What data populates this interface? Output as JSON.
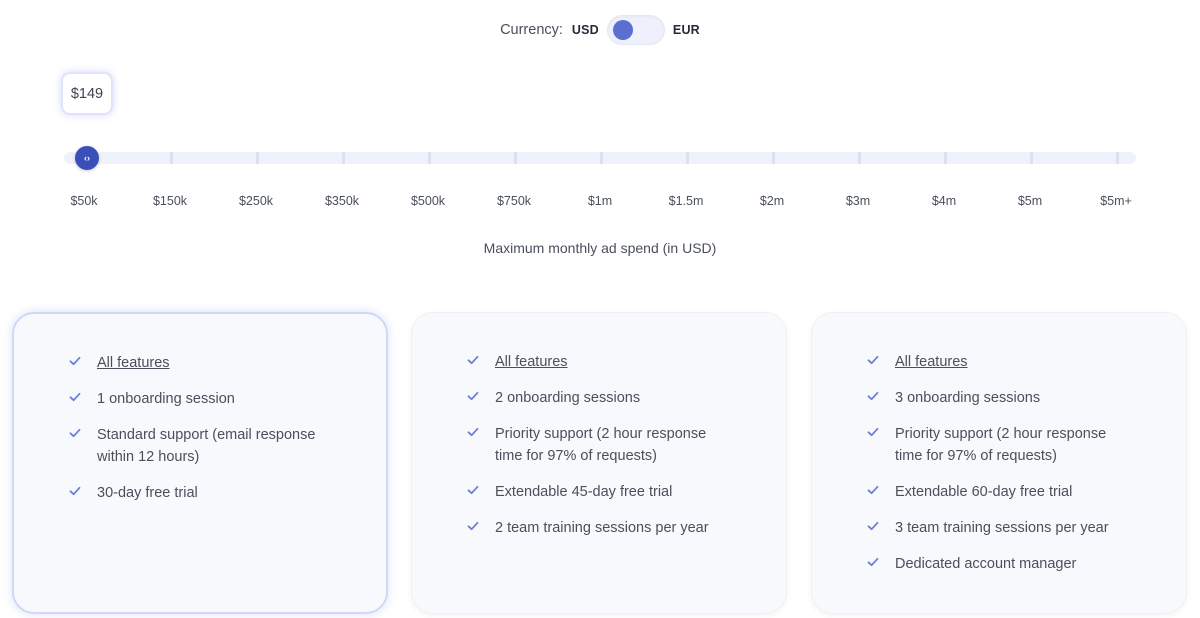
{
  "currency": {
    "label": "Currency:",
    "options": [
      "USD",
      "EUR"
    ],
    "selected": "USD"
  },
  "price": "$149",
  "slider": {
    "ticks": [
      "$50k",
      "$150k",
      "$250k",
      "$350k",
      "$500k",
      "$750k",
      "$1m",
      "$1.5m",
      "$2m",
      "$3m",
      "$4m",
      "$5m",
      "$5m+"
    ],
    "selected_index": 0,
    "thumb_icon": "‹›",
    "caption": "Maximum monthly ad spend (in USD)"
  },
  "plans": [
    {
      "selected": true,
      "features": [
        {
          "text": "All features",
          "link": true
        },
        {
          "text": "1 onboarding session"
        },
        {
          "text": "Standard support (email response",
          "text2": "within 12 hours)"
        },
        {
          "text": "30-day free trial"
        }
      ]
    },
    {
      "selected": false,
      "features": [
        {
          "text": "All features",
          "link": true
        },
        {
          "text": "2 onboarding sessions"
        },
        {
          "text": "Priority support (2 hour response",
          "text2": "time for 97% of requests)"
        },
        {
          "text": "Extendable 45-day free trial"
        },
        {
          "text": "2 team training sessions per year"
        }
      ]
    },
    {
      "selected": false,
      "features": [
        {
          "text": "All features",
          "link": true
        },
        {
          "text": "3 onboarding sessions"
        },
        {
          "text": "Priority support (2 hour response",
          "text2": "time for 97% of requests)"
        },
        {
          "text": "Extendable 60-day free trial"
        },
        {
          "text": "3 team training sessions per year"
        },
        {
          "text": "Dedicated account manager"
        }
      ]
    }
  ],
  "colors": {
    "accent": "#3a4fb8",
    "toggle_knob": "#5a6fd0",
    "check": "#6b7fd8",
    "card_bg": "#f7f9fd"
  },
  "icons": {
    "check": "check-icon",
    "slider_thumb": "slider-handle-icon"
  }
}
